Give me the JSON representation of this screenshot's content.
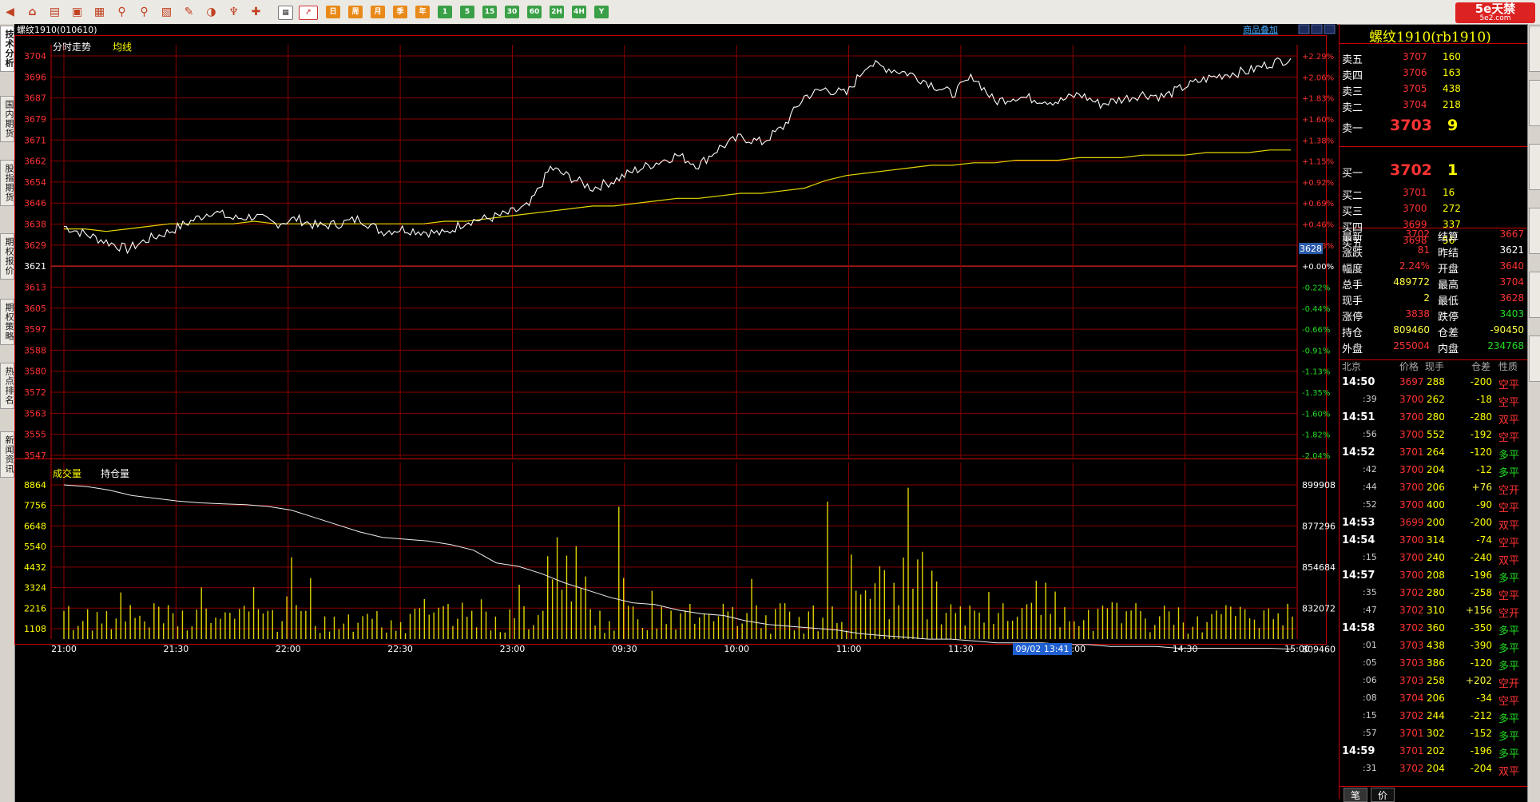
{
  "header": {
    "instrument": "螺纹1910(010610)",
    "tab_chart": "分时走势",
    "tab_avg": "均线",
    "overlay_button": "商品叠加",
    "brand": "5e天禁",
    "brand_sub": "5e2.com"
  },
  "toolbar": {
    "period_buttons": [
      "日",
      "周",
      "月",
      "季",
      "年",
      "1",
      "5",
      "15",
      "30",
      "60",
      "2H",
      "4H",
      "Y"
    ]
  },
  "left_tabs": [
    "技术分析",
    "国内期货",
    "股指期货",
    "期权报价",
    "期权策略",
    "热点排名",
    "新闻资讯"
  ],
  "price_axis": {
    "left": [
      "3704",
      "3696",
      "3687",
      "3679",
      "3671",
      "3662",
      "3654",
      "3646",
      "3638",
      "3629",
      "3621",
      "3613",
      "3605",
      "3597",
      "3588",
      "3580",
      "3572",
      "3563",
      "3555",
      "3547"
    ],
    "right": [
      "+2.29%",
      "+2.06%",
      "+1.83%",
      "+1.60%",
      "+1.38%",
      "+1.15%",
      "+0.92%",
      "+0.69%",
      "+0.46%",
      "+0.23%",
      "+0.00%",
      "-0.22%",
      "-0.44%",
      "-0.66%",
      "-0.91%",
      "-1.13%",
      "-1.35%",
      "-1.60%",
      "-1.82%",
      "-2.04%"
    ],
    "current_marker": "3628"
  },
  "volume_panel": {
    "label_volume": "成交量",
    "label_oi": "持仓量",
    "left": [
      "8864",
      "7756",
      "6648",
      "5540",
      "4432",
      "3324",
      "2216",
      "1108"
    ],
    "right": [
      "899908",
      "877296",
      "854684",
      "832072",
      "809460"
    ]
  },
  "time_axis": [
    "21:00",
    "21:30",
    "22:00",
    "22:30",
    "23:00",
    "09:30",
    "10:00",
    "11:00",
    "11:30",
    "14:00",
    "14:30",
    "15:00"
  ],
  "cursor_time": "09/02 13:41",
  "quote": {
    "title": "螺纹1910(rb1910)",
    "asks": [
      {
        "label": "卖五",
        "price": "3707",
        "vol": "160"
      },
      {
        "label": "卖四",
        "price": "3706",
        "vol": "163"
      },
      {
        "label": "卖三",
        "price": "3705",
        "vol": "438"
      },
      {
        "label": "卖二",
        "price": "3704",
        "vol": "218"
      },
      {
        "label": "卖一",
        "price": "3703",
        "vol": "9"
      }
    ],
    "bids": [
      {
        "label": "买一",
        "price": "3702",
        "vol": "1"
      },
      {
        "label": "买二",
        "price": "3701",
        "vol": "16"
      },
      {
        "label": "买三",
        "price": "3700",
        "vol": "272"
      },
      {
        "label": "买四",
        "price": "3699",
        "vol": "337"
      },
      {
        "label": "买五",
        "price": "3698",
        "vol": "56"
      }
    ],
    "stats": [
      {
        "l1": "最新",
        "v1": "3702",
        "c1": "red",
        "l2": "结算",
        "v2": "3667",
        "c2": "red"
      },
      {
        "l1": "涨跌",
        "v1": "81",
        "c1": "red",
        "l2": "昨结",
        "v2": "3621",
        "c2": "white"
      },
      {
        "l1": "幅度",
        "v1": "2.24%",
        "c1": "red",
        "l2": "开盘",
        "v2": "3640",
        "c2": "red"
      },
      {
        "l1": "总手",
        "v1": "489772",
        "c1": "yellow",
        "l2": "最高",
        "v2": "3704",
        "c2": "red"
      },
      {
        "l1": "现手",
        "v1": "2",
        "c1": "yellow",
        "l2": "最低",
        "v2": "3628",
        "c2": "red"
      },
      {
        "l1": "涨停",
        "v1": "3838",
        "c1": "red",
        "l2": "跌停",
        "v2": "3403",
        "c2": "green"
      },
      {
        "l1": "持仓",
        "v1": "809460",
        "c1": "yellow",
        "l2": "仓差",
        "v2": "-90450",
        "c2": "yellow"
      },
      {
        "l1": "外盘",
        "v1": "255004",
        "c1": "red",
        "l2": "内盘",
        "v2": "234768",
        "c2": "green"
      }
    ],
    "ticks_header": [
      "北京",
      "价格",
      "现手",
      "仓差",
      "性质"
    ],
    "ticks": [
      {
        "t": "14:50",
        "p": "3697",
        "v": "288",
        "d": "-200",
        "n": "空平",
        "big": true
      },
      {
        "t": ":39",
        "p": "3700",
        "v": "262",
        "d": "-18",
        "n": "空平",
        "big": false
      },
      {
        "t": "14:51",
        "p": "3700",
        "v": "280",
        "d": "-280",
        "n": "双平",
        "big": true
      },
      {
        "t": ":56",
        "p": "3700",
        "v": "552",
        "d": "-192",
        "n": "空平",
        "big": false
      },
      {
        "t": "14:52",
        "p": "3701",
        "v": "264",
        "d": "-120",
        "n": "多平",
        "big": true
      },
      {
        "t": ":42",
        "p": "3700",
        "v": "204",
        "d": "-12",
        "n": "多平",
        "big": false
      },
      {
        "t": ":44",
        "p": "3700",
        "v": "206",
        "d": "+76",
        "n": "空开",
        "big": false
      },
      {
        "t": ":52",
        "p": "3700",
        "v": "400",
        "d": "-90",
        "n": "空平",
        "big": false
      },
      {
        "t": "14:53",
        "p": "3699",
        "v": "200",
        "d": "-200",
        "n": "双平",
        "big": true
      },
      {
        "t": "14:54",
        "p": "3700",
        "v": "314",
        "d": "-74",
        "n": "空平",
        "big": true
      },
      {
        "t": ":15",
        "p": "3700",
        "v": "240",
        "d": "-240",
        "n": "双平",
        "big": false
      },
      {
        "t": "14:57",
        "p": "3700",
        "v": "208",
        "d": "-196",
        "n": "多平",
        "big": true
      },
      {
        "t": ":35",
        "p": "3702",
        "v": "280",
        "d": "-258",
        "n": "空平",
        "big": false
      },
      {
        "t": ":47",
        "p": "3702",
        "v": "310",
        "d": "+156",
        "n": "空开",
        "big": false
      },
      {
        "t": "14:58",
        "p": "3702",
        "v": "360",
        "d": "-350",
        "n": "多平",
        "big": true
      },
      {
        "t": ":01",
        "p": "3703",
        "v": "438",
        "d": "-390",
        "n": "多平",
        "big": false
      },
      {
        "t": ":05",
        "p": "3703",
        "v": "386",
        "d": "-120",
        "n": "多平",
        "big": false
      },
      {
        "t": ":06",
        "p": "3703",
        "v": "258",
        "d": "+202",
        "n": "空开",
        "big": false
      },
      {
        "t": ":08",
        "p": "3704",
        "v": "206",
        "d": "-34",
        "n": "空平",
        "big": false
      },
      {
        "t": ":15",
        "p": "3702",
        "v": "244",
        "d": "-212",
        "n": "多平",
        "big": false
      },
      {
        "t": ":57",
        "p": "3701",
        "v": "302",
        "d": "-152",
        "n": "多平",
        "big": false
      },
      {
        "t": "14:59",
        "p": "3701",
        "v": "202",
        "d": "-196",
        "n": "多平",
        "big": true
      },
      {
        "t": ":31",
        "p": "3702",
        "v": "204",
        "d": "-204",
        "n": "双平",
        "big": false
      }
    ],
    "bottom_tabs": [
      "笔",
      "价"
    ]
  },
  "chart_data": {
    "type": "line",
    "series": [
      {
        "name": "分时走势",
        "values": [
          3637,
          3634,
          3631,
          3628,
          3632,
          3635,
          3639,
          3643,
          3640,
          3641,
          3638,
          3640,
          3637,
          3638,
          3640,
          3635,
          3636,
          3635,
          3634,
          3639,
          3640,
          3642,
          3645,
          3660,
          3656,
          3652,
          3655,
          3659,
          3662,
          3665,
          3661,
          3668,
          3672,
          3670,
          3676,
          3688,
          3691,
          3689,
          3701,
          3699,
          3697,
          3693,
          3689,
          3696,
          3686,
          3688,
          3687,
          3686,
          3689,
          3685,
          3687,
          3689,
          3688,
          3692,
          3695,
          3697,
          3698,
          3701,
          3703
        ]
      },
      {
        "name": "均线",
        "values": [
          3636,
          3636,
          3635,
          3636,
          3637,
          3638,
          3638,
          3638,
          3638,
          3639,
          3638,
          3638,
          3638,
          3638,
          3638,
          3638,
          3638,
          3638,
          3639,
          3639,
          3640,
          3641,
          3642,
          3643,
          3644,
          3645,
          3645,
          3646,
          3647,
          3648,
          3648,
          3649,
          3650,
          3650,
          3651,
          3652,
          3655,
          3657,
          3658,
          3659,
          3660,
          3661,
          3661,
          3662,
          3662,
          3663,
          3663,
          3663,
          3664,
          3664,
          3664,
          3665,
          3665,
          3665,
          3666,
          3666,
          3666,
          3667,
          3667
        ]
      },
      {
        "name": "持仓量",
        "values": [
          899908,
          899000,
          897000,
          894000,
          892500,
          891000,
          890000,
          889500,
          889000,
          888000,
          886000,
          882000,
          878000,
          874000,
          871000,
          870000,
          869000,
          867000,
          864000,
          857000,
          855000,
          851000,
          846000,
          842000,
          838000,
          835000,
          834000,
          831000,
          829000,
          828000,
          825000,
          823000,
          822000,
          821000,
          820000,
          818000,
          817000,
          816000,
          815000,
          815000,
          814000,
          813000,
          813000,
          813000,
          812000,
          812000,
          811000,
          811000,
          811000,
          810000,
          810000,
          810000,
          810000,
          810000,
          809460
        ]
      }
    ],
    "ylim": [
      3547,
      3704
    ]
  }
}
